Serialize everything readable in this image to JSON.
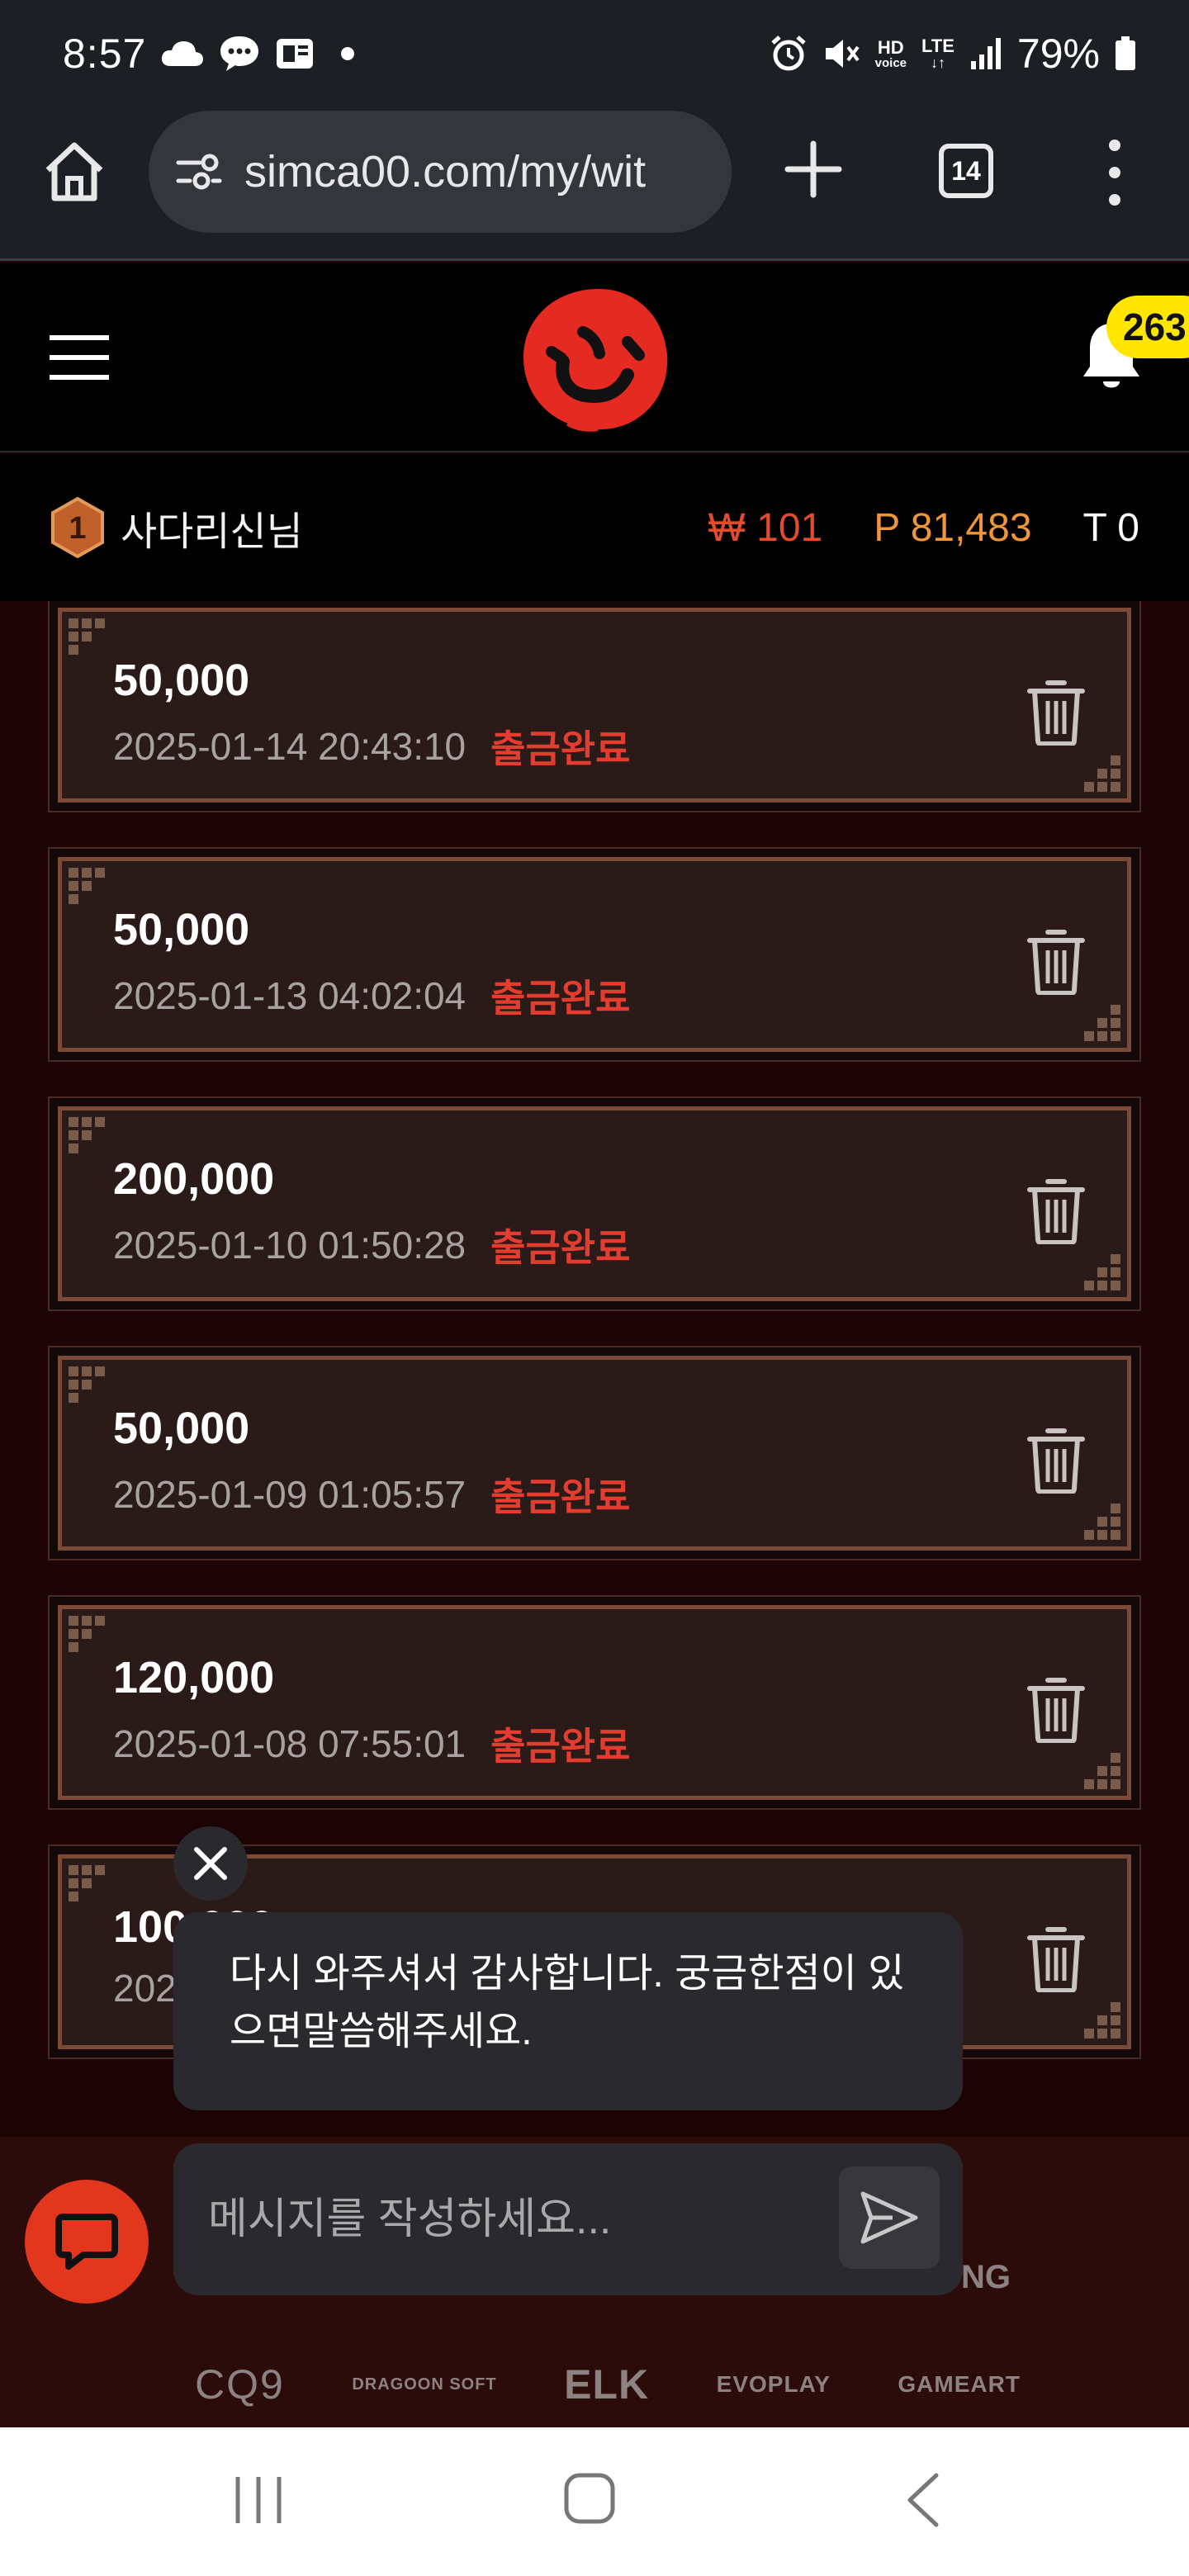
{
  "status_bar": {
    "time": "8:57",
    "hd_top": "HD",
    "hd_bottom": "voice",
    "lte_top": "LTE",
    "lte_bottom": "↓↑",
    "battery": "79%"
  },
  "browser": {
    "url": "simca00.com/my/wit",
    "tab_count": "14"
  },
  "header": {
    "notification_count": "263"
  },
  "user": {
    "level": "1",
    "name": "사다리신님",
    "won_balance": "₩ 101",
    "point_balance": "P 81,483",
    "t_balance": "T 0"
  },
  "withdrawals": [
    {
      "amount": "50,000",
      "date": "2025-01-14 20:43:10",
      "status": "출금완료"
    },
    {
      "amount": "50,000",
      "date": "2025-01-13 04:02:04",
      "status": "출금완료"
    },
    {
      "amount": "200,000",
      "date": "2025-01-10 01:50:28",
      "status": "출금완료"
    },
    {
      "amount": "50,000",
      "date": "2025-01-09 01:05:57",
      "status": "출금완료"
    },
    {
      "amount": "120,000",
      "date": "2025-01-08 07:55:01",
      "status": "출금완료"
    },
    {
      "amount": "100,000",
      "date": "2025",
      "status": ""
    }
  ],
  "chat": {
    "message": "다시 와주셔서 감사합니다. 궁금한점이 있으면말씀해주세요.",
    "input_placeholder": "메시지를 작성하세요..."
  },
  "footer": {
    "partial_text": "NG",
    "providers": [
      "CQ9",
      "DRAGOON SOFT",
      "ELK",
      "EVOPLAY",
      "GAMEART"
    ]
  },
  "colors": {
    "accent_red": "#e53c30",
    "won_color": "#e24b2b",
    "point_color": "#f0963a",
    "badge_yellow": "#ffe600",
    "chat_launcher": "#e2361d"
  }
}
